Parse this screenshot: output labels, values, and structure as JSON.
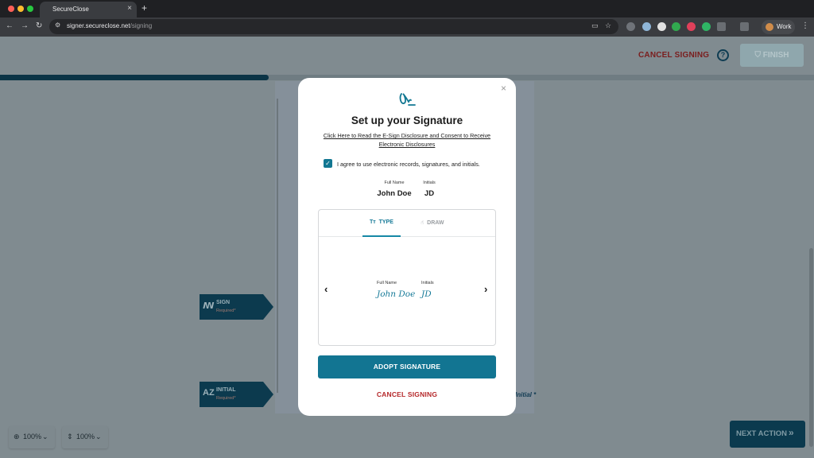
{
  "browser": {
    "tab_title": "SecureClose",
    "tab_close": "×",
    "new_tab": "+",
    "url_domain": "signer.secureclose.net",
    "url_path": "/signing",
    "profile_label": "Work",
    "nav_back": "←",
    "nav_forward": "→",
    "nav_reload": "↻",
    "menu": "⋮"
  },
  "page": {
    "cancel_label": "CANCEL SIGNING",
    "help_label": "?",
    "finish_label": "FINISH",
    "progress_fraction": 0.33,
    "sign_flag": {
      "label": "SIGN",
      "required": "Required*"
    },
    "initial_flag": {
      "icon_text": "AZ",
      "label": "INITIAL",
      "required": "Required*"
    },
    "initial_hint": "Initial *",
    "zoom_page": "100%",
    "zoom_text": "100%",
    "next_action_label": "NEXT ACTION",
    "next_action_chevron": "»"
  },
  "modal": {
    "close": "×",
    "title": "Set up your Signature",
    "disclosure_link": "Click Here to Read the E-Sign Disclosure and Consent to Receive Electronic Disclosures",
    "agree_checked": true,
    "agree_text": "I agree to use electronic records, signatures, and initials.",
    "full_name_label": "Full Name",
    "full_name": "John Doe",
    "initials_label": "Initials",
    "initials": "JD",
    "tabs": [
      {
        "label": "TYPE",
        "icon": "Tт",
        "active": true
      },
      {
        "label": "DRAW",
        "icon": "☝",
        "active": false
      }
    ],
    "preview": {
      "full_name_label": "Full Name",
      "full_name_script": "John Doe",
      "initials_label": "Initials",
      "initials_script": "JD",
      "prev_arrow": "‹",
      "next_arrow": "›"
    },
    "adopt_label": "ADOPT SIGNATURE",
    "cancel_label": "CANCEL SIGNING"
  },
  "colors": {
    "primary": "#127592",
    "danger": "#b5282a",
    "overlay_page": "#808b90"
  }
}
